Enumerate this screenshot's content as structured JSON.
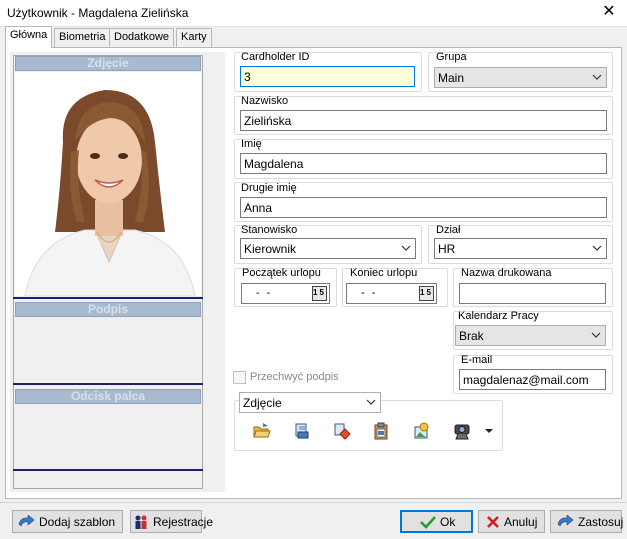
{
  "window": {
    "title": "Użytkownik - Magdalena Zielińska",
    "close_label": "✕"
  },
  "tabs": [
    {
      "label": "Główna",
      "active": true
    },
    {
      "label": "Biometria",
      "active": false
    },
    {
      "label": "Dodatkowe",
      "active": false
    },
    {
      "label": "Karty",
      "active": false
    }
  ],
  "left": {
    "photo_header": "Zdjęcie",
    "signature_header": "Podpis",
    "fingerprint_header": "Odcisk palca"
  },
  "form": {
    "cardholder_id": {
      "label": "Cardholder ID",
      "value": "3"
    },
    "grupa": {
      "label": "Grupa",
      "value": "Main"
    },
    "nazwisko": {
      "label": "Nazwisko",
      "value": "Zielińska"
    },
    "imie": {
      "label": "Imię",
      "value": "Magdalena"
    },
    "drugie_imie": {
      "label": "Drugie imię",
      "value": "Anna"
    },
    "stanowisko": {
      "label": "Stanowisko",
      "value": "Kierownik"
    },
    "dzial": {
      "label": "Dział",
      "value": "HR"
    },
    "poczatek_urlopu": {
      "label": "Początek urlopu",
      "value": "- -",
      "cal": "15"
    },
    "koniec_urlopu": {
      "label": "Koniec urlopu",
      "value": "- -",
      "cal": "15"
    },
    "nazwa_drukowana": {
      "label": "Nazwa drukowana",
      "value": ""
    },
    "kalendarz_pracy": {
      "label": "Kalendarz Pracy",
      "value": "Brak"
    },
    "email": {
      "label": "E-mail",
      "value": "magdalenaz@mail.com"
    },
    "przechwyc_podpis": {
      "label": "Przechwyć podpis",
      "checked": false
    },
    "image_type": {
      "value": "Zdjęcie"
    }
  },
  "toolbar_icons": [
    "open-folder-icon",
    "scan-icon",
    "eraser-icon",
    "paste-icon",
    "edit-image-icon",
    "webcam-icon"
  ],
  "buttons": {
    "dodaj_szablon": "Dodaj szablon",
    "rejestracje": "Rejestracje",
    "ok": "Ok",
    "anuluj": "Anuluj",
    "zastosuj": "Zastosuj"
  },
  "colors": {
    "accent": "#0078d7",
    "section_header": "#a8bad0",
    "focus_bg": "#ffffdc"
  }
}
